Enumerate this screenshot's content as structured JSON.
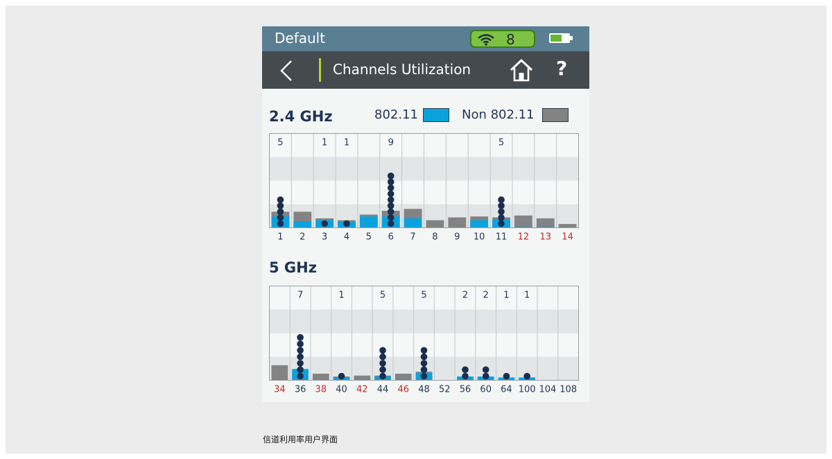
{
  "status": {
    "profile": "Default",
    "wifi_count": "8",
    "battery_level": 0.6
  },
  "nav": {
    "title": "Channels Utilization"
  },
  "legend": {
    "wifi_label": "802.11",
    "non_wifi_label": "Non 802.11"
  },
  "colors": {
    "wifi": "#0aa3de",
    "non_wifi": "#838383",
    "ap_dot": "#1a2e4f",
    "dfs_channel": "#c02828",
    "channel": "#1e3454"
  },
  "icons": {
    "back": "chevron-left-icon",
    "home": "home-icon",
    "help": "question-mark-icon",
    "wifi": "wifi-icon",
    "battery": "battery-icon"
  },
  "chart_data": [
    {
      "type": "bar",
      "title": "2.4 GHz",
      "ylim": [
        0,
        100
      ],
      "categories": [
        "1",
        "2",
        "3",
        "4",
        "5",
        "6",
        "7",
        "8",
        "9",
        "10",
        "11",
        "12",
        "13",
        "14"
      ],
      "dfs_or_restricted": [
        false,
        false,
        false,
        false,
        false,
        false,
        false,
        false,
        false,
        false,
        false,
        true,
        true,
        true
      ],
      "ap_counts": [
        "5",
        "",
        "1",
        "1",
        "",
        "9",
        "",
        "",
        "",
        "",
        "5",
        "",
        "",
        ""
      ],
      "series": [
        {
          "name": "802.11",
          "values": [
            12,
            7,
            8,
            6,
            12,
            12,
            10,
            0,
            0,
            8,
            9,
            1,
            1,
            0
          ]
        },
        {
          "name": "Non 802.11",
          "values": [
            17,
            17,
            10,
            8,
            14,
            18,
            20,
            8,
            11,
            12,
            11,
            13,
            10,
            4
          ]
        }
      ]
    },
    {
      "type": "bar",
      "title": "5 GHz",
      "ylim": [
        0,
        100
      ],
      "categories": [
        "34",
        "36",
        "38",
        "40",
        "42",
        "44",
        "46",
        "48",
        "52",
        "56",
        "60",
        "64",
        "100",
        "104",
        "108"
      ],
      "dfs_or_restricted": [
        true,
        false,
        true,
        false,
        true,
        false,
        true,
        false,
        false,
        false,
        false,
        false,
        false,
        false,
        false
      ],
      "ap_counts": [
        "",
        "7",
        "",
        "1",
        "",
        "5",
        "",
        "5",
        "",
        "2",
        "2",
        "1",
        "1",
        "",
        ""
      ],
      "series": [
        {
          "name": "802.11",
          "values": [
            0,
            12,
            0,
            3,
            0,
            4,
            0,
            8,
            0,
            4,
            4,
            3,
            3,
            0,
            0
          ]
        },
        {
          "name": "Non 802.11",
          "values": [
            16,
            10,
            7,
            4,
            5,
            5,
            7,
            9,
            0,
            2,
            3,
            1,
            1,
            0,
            0
          ]
        }
      ]
    }
  ],
  "caption": "信道利用率用户界面"
}
